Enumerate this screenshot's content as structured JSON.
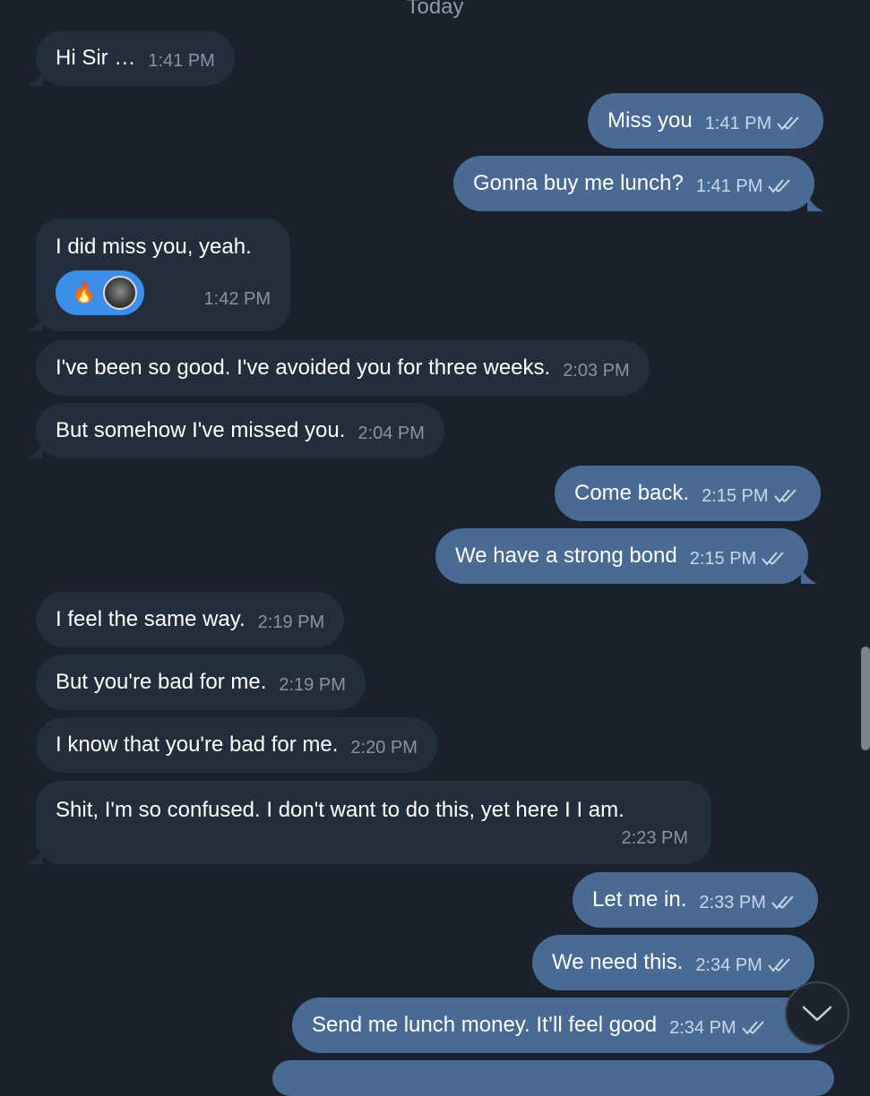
{
  "chat": {
    "date_label": "Today",
    "messages": [
      {
        "text": "Hi Sir …",
        "time": "1:41 PM"
      },
      {
        "text": "Miss you",
        "time": "1:41 PM"
      },
      {
        "text": "Gonna buy me lunch?",
        "time": "1:41 PM"
      },
      {
        "text": "I did miss you, yeah.",
        "time": "1:42 PM",
        "reactions": [
          "🔥",
          "avatar"
        ]
      },
      {
        "text": "I've been so good. I've avoided you for three weeks.",
        "time": "2:03 PM"
      },
      {
        "text": "But somehow I've missed you.",
        "time": "2:04 PM"
      },
      {
        "text": "Come back.",
        "time": "2:15 PM"
      },
      {
        "text": "We have a strong bond",
        "time": "2:15 PM"
      },
      {
        "text": "I feel the same way.",
        "time": "2:19 PM"
      },
      {
        "text": "But you're bad for me.",
        "time": "2:19 PM"
      },
      {
        "text": "I know that you're bad for me.",
        "time": "2:20 PM"
      },
      {
        "text": "Shit, I'm so confused. I don't want to do this, yet here I I am.",
        "time": "2:23 PM"
      },
      {
        "text": "Let me in.",
        "time": "2:33 PM"
      },
      {
        "text": "We need this.",
        "time": "2:34 PM"
      },
      {
        "text": "Send me lunch money. It’ll feel good",
        "time": "2:34 PM"
      }
    ]
  },
  "colors": {
    "background": "#1a202c",
    "incoming_bubble": "#232e3c",
    "outgoing_bubble": "#496a92",
    "reaction_pill": "#3d8ee8"
  },
  "icons": {
    "read_receipt": "double-check-icon",
    "scroll_down": "chevron-down-icon"
  }
}
